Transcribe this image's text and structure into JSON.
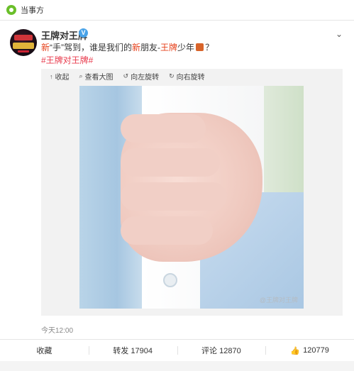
{
  "topbar": {
    "label": "当事方"
  },
  "post": {
    "username": "王牌对王牌",
    "verified_mark": "V",
    "content": {
      "p1": "新",
      "p2": "“手”驾到，谁是我们的",
      "p3": "新",
      "p4": "朋友-",
      "p5": "王牌",
      "p6": "少年",
      "p7": "？"
    },
    "hashtag": "#王牌对王牌#",
    "media_toolbar": [
      {
        "icon": "collapse-icon",
        "label": "收起"
      },
      {
        "icon": "magnify-icon",
        "label": "查看大图"
      },
      {
        "icon": "rotate-left-icon",
        "label": "向左旋转"
      },
      {
        "icon": "rotate-right-icon",
        "label": "向右旋转"
      }
    ],
    "watermark": "@王牌对王牌",
    "time": "今天12:00",
    "actions": {
      "collect": "收藏",
      "repost": "转发 17904",
      "comment": "评论 12870",
      "like": "120779"
    }
  }
}
